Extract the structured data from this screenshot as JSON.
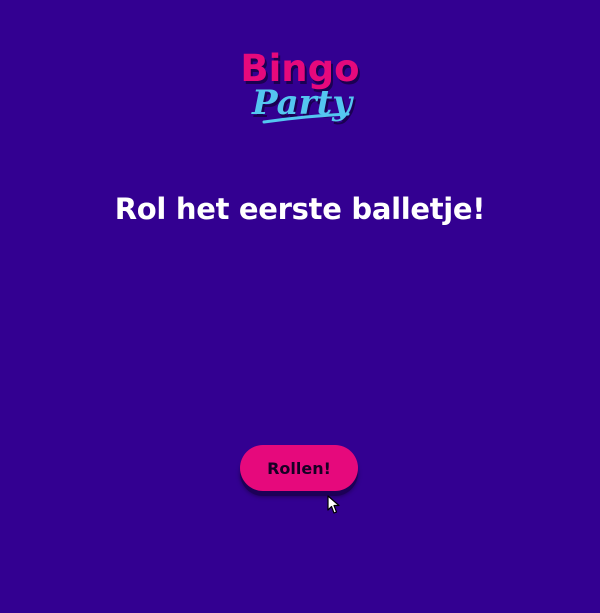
{
  "logo": {
    "line1": "Bingo",
    "line2": "Party",
    "colors": {
      "bingo": "#e6097c",
      "party": "#54c6f0"
    }
  },
  "headline": "Rol het eerste balletje!",
  "roll_button": {
    "label": "Rollen!"
  },
  "colors": {
    "background": "#330091",
    "button": "#e6097c",
    "text": "#ffffff"
  }
}
